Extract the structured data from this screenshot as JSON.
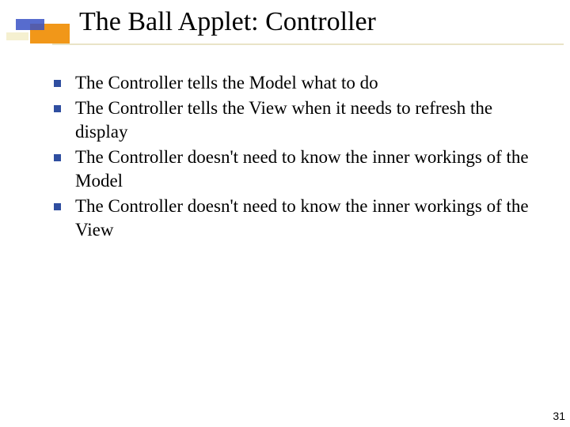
{
  "title": "The Ball Applet: Controller",
  "bullets": {
    "b0": "The Controller tells the Model what to do",
    "b1": "The Controller tells the View when it needs to refresh the display",
    "b2": "The Controller doesn't need to know the inner workings of the Model",
    "b3": "The Controller doesn't need to know the inner workings of the View"
  },
  "page_number": "31",
  "colors": {
    "bullet": "#2f4ea0",
    "accent_orange": "#ef8c00",
    "accent_blue": "#3a52c5",
    "accent_ivory": "#f5f0d0"
  }
}
